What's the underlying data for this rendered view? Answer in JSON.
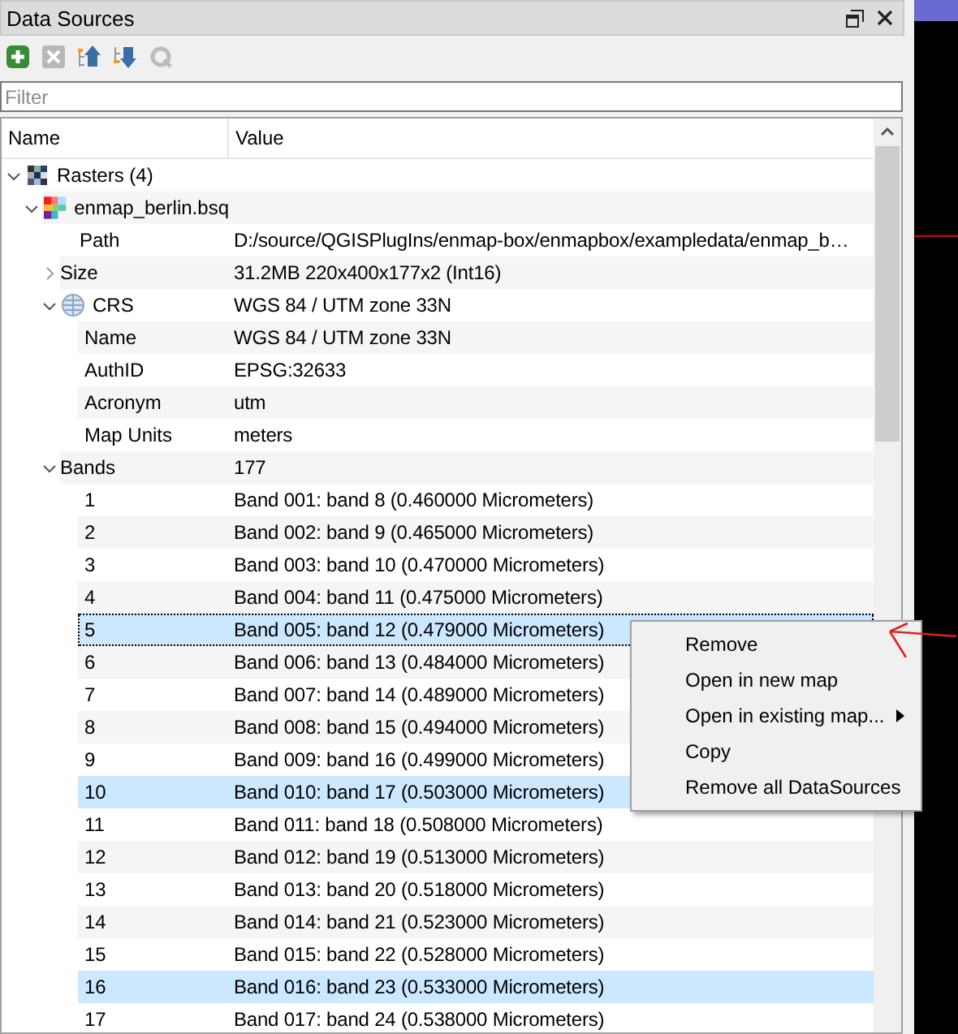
{
  "panel": {
    "title": "Data Sources"
  },
  "toolbar": [
    {
      "kind": "add",
      "disabled": false
    },
    {
      "kind": "remove",
      "disabled": true
    },
    {
      "kind": "up",
      "disabled": false
    },
    {
      "kind": "down",
      "disabled": false
    },
    {
      "kind": "refresh",
      "disabled": true
    }
  ],
  "filter": {
    "placeholder": "Filter"
  },
  "columns": [
    "Name",
    "Value"
  ],
  "tree": [
    {
      "name": "Rasters (4)",
      "kind": "raster-group",
      "expanded": true,
      "children": [
        {
          "name": "enmap_berlin.bsq",
          "kind": "raster",
          "expanded": true,
          "children": [
            {
              "name": "Path",
              "value": "D:/source/QGISPlugIns/enmap-box/enmapbox/exampledata/enmap_b…"
            },
            {
              "name": "Size",
              "value": "31.2MB 220x400x177x2 (Int16)",
              "expanded": false
            },
            {
              "name": "CRS",
              "value": "WGS 84 / UTM zone 33N",
              "kind": "globe",
              "expanded": true,
              "children": [
                {
                  "name": "Name",
                  "value": "WGS 84 / UTM zone 33N"
                },
                {
                  "name": "AuthID",
                  "value": "EPSG:32633"
                },
                {
                  "name": "Acronym",
                  "value": "utm"
                },
                {
                  "name": "Map Units",
                  "value": "meters"
                }
              ]
            },
            {
              "name": "Bands",
              "value": "177",
              "expanded": true,
              "children": [
                {
                  "name": "1",
                  "value": "Band 001: band 8 (0.460000 Micrometers)",
                  "selected": false,
                  "focused": false
                },
                {
                  "name": "2",
                  "value": "Band 002: band 9 (0.465000 Micrometers)",
                  "selected": false,
                  "focused": false
                },
                {
                  "name": "3",
                  "value": "Band 003: band 10 (0.470000 Micrometers)",
                  "selected": false,
                  "focused": false
                },
                {
                  "name": "4",
                  "value": "Band 004: band 11 (0.475000 Micrometers)",
                  "selected": false,
                  "focused": false
                },
                {
                  "name": "5",
                  "value": "Band 005: band 12 (0.479000 Micrometers)",
                  "selected": true,
                  "focused": true
                },
                {
                  "name": "6",
                  "value": "Band 006: band 13 (0.484000 Micrometers)",
                  "selected": false,
                  "focused": false
                },
                {
                  "name": "7",
                  "value": "Band 007: band 14 (0.489000 Micrometers)",
                  "selected": false,
                  "focused": false
                },
                {
                  "name": "8",
                  "value": "Band 008: band 15 (0.494000 Micrometers)",
                  "selected": false,
                  "focused": false
                },
                {
                  "name": "9",
                  "value": "Band 009: band 16 (0.499000 Micrometers)",
                  "selected": false,
                  "focused": false
                },
                {
                  "name": "10",
                  "value": "Band 010: band 17 (0.503000 Micrometers)",
                  "selected": true,
                  "focused": false
                },
                {
                  "name": "11",
                  "value": "Band 011: band 18 (0.508000 Micrometers)",
                  "selected": false,
                  "focused": false
                },
                {
                  "name": "12",
                  "value": "Band 012: band 19 (0.513000 Micrometers)",
                  "selected": false,
                  "focused": false
                },
                {
                  "name": "13",
                  "value": "Band 013: band 20 (0.518000 Micrometers)",
                  "selected": false,
                  "focused": false
                },
                {
                  "name": "14",
                  "value": "Band 014: band 21 (0.523000 Micrometers)",
                  "selected": false,
                  "focused": false
                },
                {
                  "name": "15",
                  "value": "Band 015: band 22 (0.528000 Micrometers)",
                  "selected": false,
                  "focused": false
                },
                {
                  "name": "16",
                  "value": "Band 016: band 23 (0.533000 Micrometers)",
                  "selected": true,
                  "focused": false
                },
                {
                  "name": "17",
                  "value": "Band 017: band 24 (0.538000 Micrometers)",
                  "selected": false,
                  "focused": false
                }
              ]
            }
          ]
        }
      ]
    }
  ],
  "context_menu": [
    {
      "label": "Remove",
      "has_submenu": false
    },
    {
      "label": "Open in new map",
      "has_submenu": false
    },
    {
      "label": "Open in existing map...",
      "has_submenu": true
    },
    {
      "label": "Copy",
      "has_submenu": false
    },
    {
      "label": "Remove all DataSources",
      "has_submenu": false
    }
  ]
}
